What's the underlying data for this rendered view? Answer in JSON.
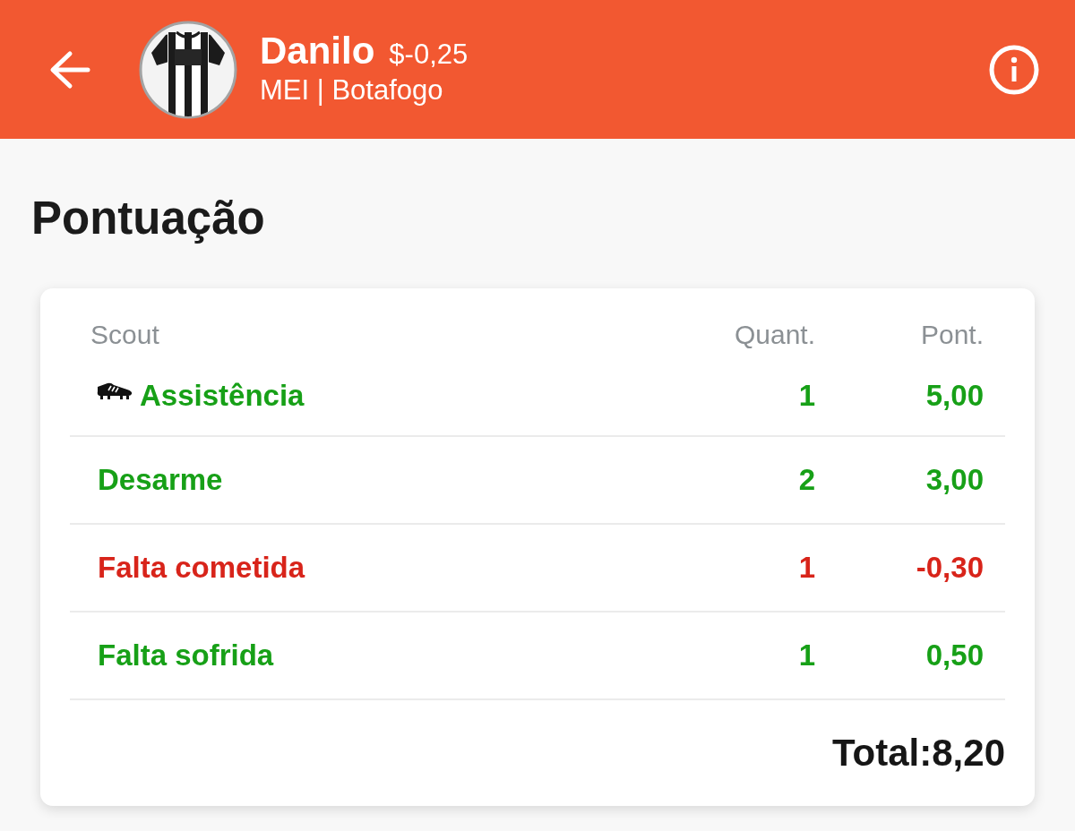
{
  "header": {
    "player_name": "Danilo",
    "price": "$-0,25",
    "subtitle": "MEI | Botafogo"
  },
  "section_title": "Pontuação",
  "table": {
    "columns": [
      "Scout",
      "Quant.",
      "Pont."
    ],
    "rows": [
      {
        "scout": "Assistência",
        "quantity": "1",
        "points": "5,00",
        "negative": false,
        "icon": true
      },
      {
        "scout": "Desarme",
        "quantity": "2",
        "points": "3,00",
        "negative": false,
        "icon": false
      },
      {
        "scout": "Falta cometida",
        "quantity": "1",
        "points": "-0,30",
        "negative": true,
        "icon": false
      },
      {
        "scout": "Falta sofrida",
        "quantity": "1",
        "points": "0,50",
        "negative": false,
        "icon": false
      }
    ]
  },
  "total": "Total:8,20"
}
